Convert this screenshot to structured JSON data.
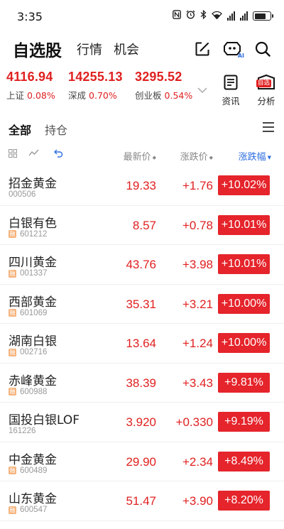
{
  "status_bar": {
    "time": "3:35",
    "battery_level": 0.75
  },
  "header": {
    "tabs": [
      {
        "label": "自选股",
        "active": true
      },
      {
        "label": "行情",
        "active": false
      },
      {
        "label": "机会",
        "active": false
      }
    ],
    "ai_badge": "AI"
  },
  "indices": [
    {
      "value": "4116.94",
      "name": "上证",
      "pct": "0.08%"
    },
    {
      "value": "14255.13",
      "name": "深成",
      "pct": "0.70%"
    },
    {
      "value": "3295.52",
      "name": "创业板",
      "pct": "0.54%"
    }
  ],
  "side_buttons": {
    "news": "资讯",
    "analysis": "分析",
    "analysis_badge": "自选"
  },
  "list_tabs": [
    {
      "label": "全部",
      "active": true
    },
    {
      "label": "持仓",
      "active": false
    }
  ],
  "columns": {
    "price": "最新价",
    "change": "涨跌价",
    "pct": "涨跌幅"
  },
  "colors": {
    "up": "#e02020",
    "badge": "#e5242b",
    "active_sort": "#2f6fe0"
  },
  "stocks": [
    {
      "name": "招金黄金",
      "code": "000506",
      "tag": "",
      "price": "19.33",
      "change": "+1.76",
      "pct": "+10.02%"
    },
    {
      "name": "白银有色",
      "code": "601212",
      "tag": "融",
      "price": "8.57",
      "change": "+0.78",
      "pct": "+10.01%"
    },
    {
      "name": "四川黄金",
      "code": "001337",
      "tag": "融",
      "price": "43.76",
      "change": "+3.98",
      "pct": "+10.01%"
    },
    {
      "name": "西部黄金",
      "code": "601069",
      "tag": "融",
      "price": "35.31",
      "change": "+3.21",
      "pct": "+10.00%"
    },
    {
      "name": "湖南白银",
      "code": "002716",
      "tag": "融",
      "price": "13.64",
      "change": "+1.24",
      "pct": "+10.00%"
    },
    {
      "name": "赤峰黄金",
      "code": "600988",
      "tag": "融",
      "price": "38.39",
      "change": "+3.43",
      "pct": "+9.81%"
    },
    {
      "name": "国投白银LOF",
      "code": "161226",
      "tag": "",
      "price": "3.920",
      "change": "+0.330",
      "pct": "+9.19%"
    },
    {
      "name": "中金黄金",
      "code": "600489",
      "tag": "融",
      "price": "29.90",
      "change": "+2.34",
      "pct": "+8.49%"
    },
    {
      "name": "山东黄金",
      "code": "600547",
      "tag": "融",
      "price": "51.47",
      "change": "+3.90",
      "pct": "+8.20%"
    }
  ]
}
